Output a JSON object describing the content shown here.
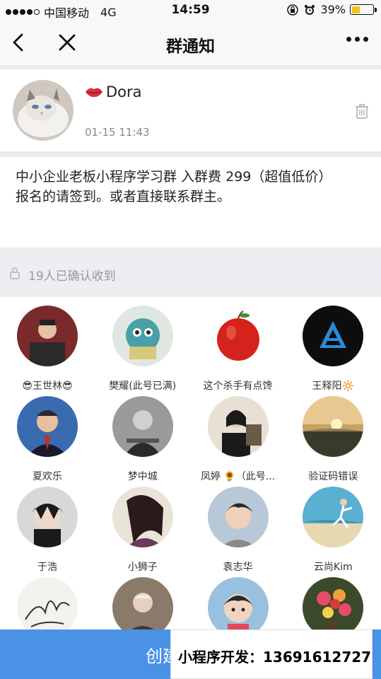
{
  "status_bar": {
    "carrier": "中国移动",
    "network": "4G",
    "time": "14:59",
    "battery": "39%",
    "battery_level": 0.39
  },
  "nav": {
    "title": "群通知"
  },
  "author": {
    "name": "Dora",
    "time": "01-15 11:43"
  },
  "message": {
    "line1": "中小企业老板小程序学习群 入群费 299（超值低价）",
    "line2": "报名的请签到。或者直接联系群主。"
  },
  "confirm": {
    "text": "19人已确认收到"
  },
  "members": [
    {
      "name": "😎王世林😎"
    },
    {
      "name": "樊耀(此号已满)"
    },
    {
      "name": "这个杀手有点馋"
    },
    {
      "name": "王释阳🔆"
    },
    {
      "name": "夏欢乐"
    },
    {
      "name": "梦中城"
    },
    {
      "name": "凤婷 🌻（此号..."
    },
    {
      "name": "验证码错误"
    },
    {
      "name": "于浩"
    },
    {
      "name": "小狮子"
    },
    {
      "name": "袁志华"
    },
    {
      "name": "云尚Kim"
    },
    {
      "name": ""
    },
    {
      "name": ""
    },
    {
      "name": ""
    },
    {
      "name": ""
    }
  ],
  "bottom": {
    "button_label": "创建",
    "promo": "小程序开发：13691612727"
  }
}
